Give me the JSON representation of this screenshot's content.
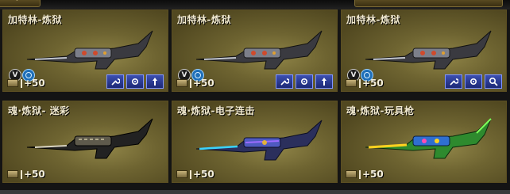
{
  "cards": [
    {
      "name": "加特林-炼狱",
      "ammo": "+50",
      "badges": true,
      "icons": [
        "wrench-icon",
        "gear-icon",
        "up-arrow-icon"
      ],
      "palette": "steel"
    },
    {
      "name": "加特林-炼狱",
      "ammo": "+50",
      "badges": true,
      "icons": [
        "wrench-icon",
        "gear-icon",
        "up-arrow-icon"
      ],
      "palette": "steel"
    },
    {
      "name": "加特林-炼狱",
      "ammo": "+50",
      "badges": true,
      "icons": [
        "wrench-icon",
        "gear-icon",
        "magnifier-icon"
      ],
      "palette": "steel"
    },
    {
      "name": "魂·炼狱- 迷彩",
      "ammo": "+50",
      "badges": false,
      "icons": [],
      "palette": "camo"
    },
    {
      "name": "魂·炼狱-电子连击",
      "ammo": "+50",
      "badges": false,
      "icons": [],
      "palette": "electric"
    },
    {
      "name": "魂·炼狱-玩具枪",
      "ammo": "+50",
      "badges": false,
      "icons": [],
      "palette": "toy"
    }
  ],
  "badge_text": "V",
  "colors": {
    "accent_button": "#2f3f9f",
    "card_border": "#5c4f22",
    "text": "#f1e9cf"
  }
}
